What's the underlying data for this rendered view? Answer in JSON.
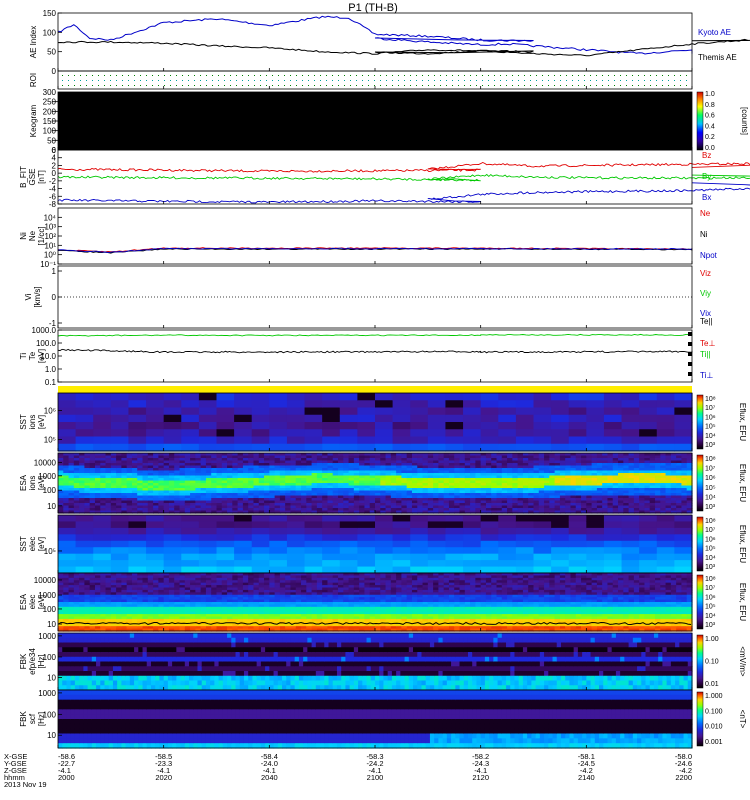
{
  "title": "P1 (TH-B)",
  "colors": {
    "kyoto": "#0000c8",
    "themis": "#000000",
    "red": "#e00000",
    "green": "#00c800",
    "blue": "#0000c8",
    "black": "#000000"
  },
  "chart_data": [
    {
      "type": "line",
      "ylabel": "AE Index",
      "ylim": [
        0,
        150
      ],
      "ticks": [
        "150",
        "100",
        "50",
        "0"
      ],
      "series": [
        {
          "name": "Kyoto AE",
          "x": [
            2000,
            2003,
            2006,
            2010,
            2020,
            2030,
            2040,
            2050,
            2055,
            2060,
            2070,
            2080,
            2090,
            2100,
            2110,
            2120,
            2125,
            2130,
            2140,
            2150,
            2160,
            2200
          ],
          "values": [
            100,
            120,
            85,
            80,
            125,
            135,
            118,
            140,
            138,
            95,
            90,
            80,
            78,
            85,
            75,
            68,
            70,
            65,
            55,
            45,
            55,
            45
          ]
        },
        {
          "name": "Themis AE",
          "x": [
            2000,
            2010,
            2020,
            2030,
            2040,
            2050,
            2060,
            2070,
            2080,
            2090,
            2100,
            2110,
            2120,
            2130,
            2140,
            2150,
            2160,
            2170,
            2180,
            2190,
            2200
          ],
          "values": [
            75,
            75,
            72,
            65,
            60,
            50,
            45,
            55,
            52,
            50,
            48,
            45,
            52,
            45,
            40,
            55,
            70,
            80,
            75,
            80,
            78
          ]
        }
      ]
    },
    {
      "type": "table",
      "ylabel": "ROI"
    },
    {
      "type": "heatmap",
      "ylabel": "Keogram",
      "yticks": [
        "300",
        "250",
        "200",
        "150",
        "100",
        "50",
        "0"
      ],
      "colorbar_label": "[counts]",
      "colorbar_ticks": [
        "1.0",
        "0.8",
        "0.6",
        "0.4",
        "0.2",
        "0.0"
      ]
    },
    {
      "type": "line",
      "ylabel": "B_FIT\nGSE\n[nT]",
      "ylim": [
        -8,
        6
      ],
      "ticks": [
        "6",
        "4",
        "2",
        "0",
        "-2",
        "-4",
        "-6",
        "-8"
      ],
      "series": [
        {
          "name": "Bz",
          "x": [
            2000,
            2020,
            2040,
            2060,
            2080,
            2110,
            2120,
            2130,
            2140,
            2160,
            2180,
            2200
          ],
          "values": [
            1,
            0.8,
            0.5,
            0.6,
            0.8,
            1,
            2.5,
            1.8,
            2,
            2.3,
            2.6,
            1.5
          ]
        },
        {
          "name": "By",
          "x": [
            2000,
            2020,
            2040,
            2060,
            2080,
            2110,
            2120,
            2130,
            2140,
            2160,
            2180,
            2200
          ],
          "values": [
            -1,
            -1.2,
            -1.3,
            -1.5,
            -1.8,
            -1.6,
            -0.5,
            -1,
            -1.2,
            -1.3,
            -1,
            -0.5
          ]
        },
        {
          "name": "Bx",
          "x": [
            2000,
            2020,
            2040,
            2060,
            2080,
            2110,
            2120,
            2130,
            2140,
            2160,
            2180,
            2200
          ],
          "values": [
            -7,
            -7.3,
            -7.5,
            -7.2,
            -7.4,
            -6.8,
            -5.5,
            -5,
            -4.8,
            -4.5,
            -3.5,
            -2.5
          ]
        }
      ]
    },
    {
      "type": "line",
      "ylabel": "Ni\nNe\n[1/cc]",
      "ylim": [
        -1,
        5
      ],
      "ticks": [
        "10⁴",
        "10³",
        "10²",
        "10¹",
        "10⁰",
        "10⁻¹"
      ],
      "series": [
        {
          "name": "Ne",
          "x": [
            2000,
            2010,
            2020,
            2040,
            2080,
            2120,
            2160,
            2200
          ],
          "values": [
            0.5,
            0.3,
            0.7,
            0.7,
            0.7,
            0.7,
            0.6,
            0.7
          ]
        },
        {
          "name": "Ni",
          "x": [
            2000,
            2010,
            2020,
            2040,
            2080,
            2120,
            2160,
            2200
          ],
          "values": [
            0.45,
            0.2,
            0.6,
            0.6,
            0.6,
            0.6,
            0.55,
            0.6
          ]
        },
        {
          "name": "Npot",
          "x": [
            2000,
            2010,
            2020,
            2040,
            2080,
            2120,
            2160,
            2200
          ],
          "values": [
            0.5,
            0.25,
            0.65,
            0.65,
            0.65,
            0.65,
            0.6,
            0.65
          ]
        }
      ]
    },
    {
      "type": "line",
      "ylabel": "Vi\n[km/s]",
      "ticks": [
        "1",
        "0",
        "-1"
      ],
      "series": [
        {
          "name": "Viz",
          "values": []
        },
        {
          "name": "Viy",
          "values": []
        },
        {
          "name": "Vix",
          "values": []
        }
      ]
    },
    {
      "type": "line",
      "ylabel": "Ti\nTe\n[eV]",
      "ylim": [
        0.1,
        1000
      ],
      "ticks": [
        "1000.0",
        "100.0",
        "10.0",
        "1.0",
        "0.1"
      ],
      "series": [
        {
          "name": "Te||",
          "values": []
        },
        {
          "name": "Te⊥",
          "values": []
        },
        {
          "name": "Ti||",
          "x": [
            2000,
            2020,
            2040,
            2080,
            2120,
            2160,
            2200
          ],
          "values": [
            350,
            400,
            380,
            400,
            420,
            420,
            500
          ]
        },
        {
          "name": "Ti⊥",
          "x": [
            2000,
            2010,
            2020,
            2040,
            2080,
            2120,
            2160,
            2200
          ],
          "values": [
            30,
            25,
            20,
            20,
            22,
            20,
            22,
            25
          ]
        }
      ]
    },
    {
      "type": "heatmap",
      "ylabel": "SST\nions\n[eV]",
      "yticks": [
        "10⁶",
        "10⁵"
      ],
      "colorbar_label": "Eflux, EFU",
      "colorbar_ticks": [
        "10⁸",
        "10⁷",
        "10⁶",
        "10⁵",
        "10⁴",
        "10³"
      ]
    },
    {
      "type": "heatmap",
      "ylabel": "ESA\nions\n[eV]",
      "yticks": [
        "10000",
        "1000",
        "100",
        "10"
      ],
      "colorbar_label": "Eflux, EFU",
      "colorbar_ticks": [
        "10⁸",
        "10⁷",
        "10⁶",
        "10⁵",
        "10⁴",
        "10³"
      ]
    },
    {
      "type": "heatmap",
      "ylabel": "SST\nelec\n[eV]",
      "yticks": [
        "10⁵"
      ],
      "colorbar_label": "Eflux, EFU",
      "colorbar_ticks": [
        "10⁸",
        "10⁷",
        "10⁶",
        "10⁵",
        "10⁴",
        "10³"
      ]
    },
    {
      "type": "heatmap",
      "ylabel": "ESA\nelec\n[eV]",
      "yticks": [
        "10000",
        "1000",
        "100",
        "10"
      ],
      "colorbar_label": "Eflux, EFU",
      "colorbar_ticks": [
        "10⁸",
        "10⁷",
        "10⁶",
        "10⁵",
        "10⁴",
        "10³"
      ]
    },
    {
      "type": "heatmap",
      "ylabel": "FBK\nefp/e34\n[Hz]",
      "yticks": [
        "1000",
        "100",
        "10"
      ],
      "colorbar_label": "<mV/m>",
      "colorbar_ticks": [
        "1.00",
        "0.10",
        "0.01"
      ]
    },
    {
      "type": "heatmap",
      "ylabel": "FBK\nscf\n[Hz]",
      "yticks": [
        "1000",
        "100",
        "10"
      ],
      "colorbar_label": "<nT>",
      "colorbar_ticks": [
        "1.000",
        "0.100",
        "0.010",
        "0.001"
      ]
    }
  ],
  "ephemeris": {
    "labels": [
      "X-GSE",
      "Y-GSE",
      "Z-GSE",
      "hhmm",
      "2013 Nov 19"
    ],
    "columns": [
      [
        "-58.6",
        "-22.7",
        "-4.1",
        "2000"
      ],
      [
        "-58.5",
        "-23.3",
        "-4.1",
        "2020"
      ],
      [
        "-58.4",
        "-24.0",
        "-4.1",
        "2040"
      ],
      [
        "-58.3",
        "-24.2",
        "-4.1",
        "2100"
      ],
      [
        "-58.2",
        "-24.3",
        "-4.1",
        "2120"
      ],
      [
        "-58.1",
        "-24.5",
        "-4.2",
        "2140"
      ],
      [
        "-58.0",
        "-24.6",
        "-4.2",
        "2200"
      ]
    ]
  }
}
